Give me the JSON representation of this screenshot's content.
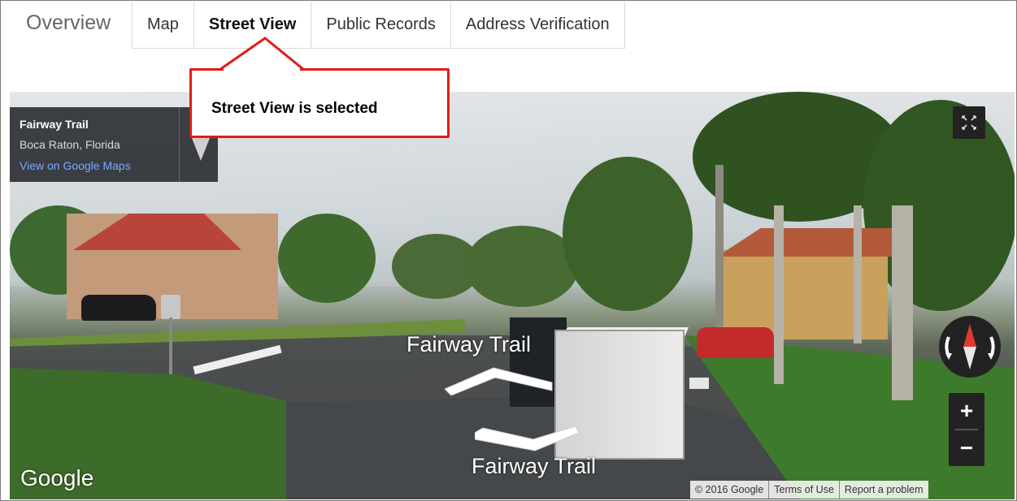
{
  "tabs": {
    "overview": "Overview",
    "items": [
      "Map",
      "Street View",
      "Public Records",
      "Address Verification"
    ],
    "active": "Street View"
  },
  "callout": {
    "text": "Street View is selected",
    "border_color": "#e11b1b"
  },
  "street_view": {
    "location_title": "Fairway Trail",
    "location_subtitle": "Boca Raton, Florida",
    "maps_link": "View on Google Maps",
    "road_labels": [
      "Fairway Trail",
      "Fairway Trail"
    ],
    "logo": "Google",
    "footer": [
      "© 2016 Google",
      "Terms of Use",
      "Report a problem"
    ],
    "zoom_in": "+",
    "zoom_out": "−",
    "icons": [
      "pin-icon",
      "fullscreen-icon",
      "compass-icon",
      "chevron-arrow-icon"
    ]
  }
}
